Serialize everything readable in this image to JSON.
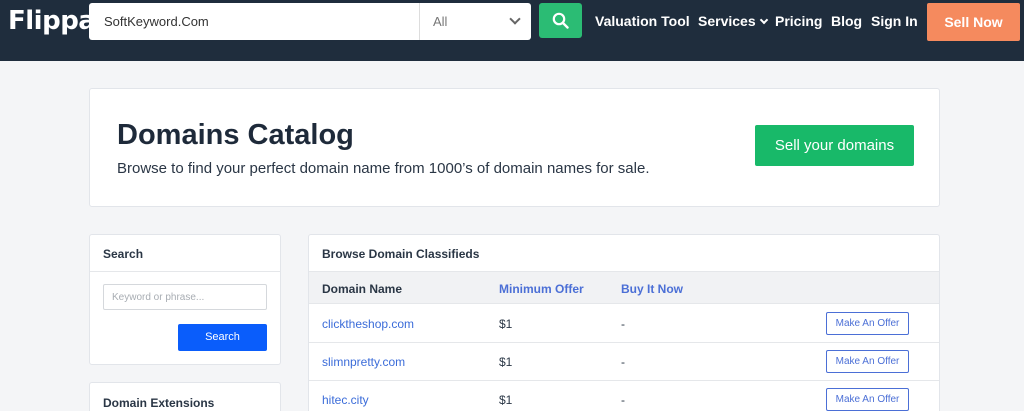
{
  "header": {
    "logo": "Flippa",
    "search_value": "SoftKeyword.Com",
    "category": "All",
    "nav": {
      "valuation": "Valuation Tool",
      "services": "Services",
      "pricing": "Pricing",
      "blog": "Blog",
      "signin": "Sign In"
    },
    "sell_now": "Sell Now",
    "colors": {
      "nav_bg": "#1f2d3d",
      "search_button": "#2bbc74",
      "sell_now": "#f58a5e"
    }
  },
  "catalog": {
    "title": "Domains Catalog",
    "subtitle": "Browse to find your perfect domain name from 1000’s of domain names for sale.",
    "sell_button": "Sell your domains"
  },
  "sidebar": {
    "search_title": "Search",
    "keyword_placeholder": "Keyword or phrase...",
    "search_button": "Search",
    "extensions_title": "Domain Extensions"
  },
  "classifieds": {
    "title": "Browse Domain Classifieds",
    "columns": {
      "domain": "Domain Name",
      "min_offer": "Minimum Offer",
      "buy_now": "Buy It Now"
    },
    "rows": [
      {
        "domain": "clicktheshop.com",
        "min_offer": "$1",
        "buy_now": "-",
        "action": "Make An Offer"
      },
      {
        "domain": "slimnpretty.com",
        "min_offer": "$1",
        "buy_now": "-",
        "action": "Make An Offer"
      },
      {
        "domain": "hitec.city",
        "min_offer": "$1",
        "buy_now": "-",
        "action": "Make An Offer"
      }
    ]
  }
}
